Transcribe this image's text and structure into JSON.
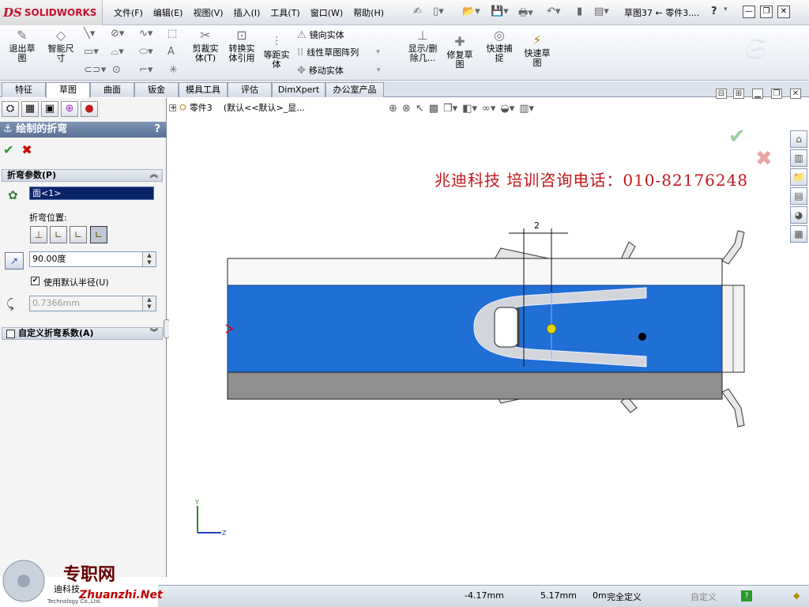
{
  "app": {
    "logo_mark": "DS",
    "logo_text": "SOLIDWORKS",
    "doc_title": "草图37 ← 零件3....",
    "help_glyph": "?",
    "win_min": "—",
    "win_restore": "❐",
    "win_close": "✕"
  },
  "menu": [
    "文件(F)",
    "编辑(E)",
    "视图(V)",
    "插入(I)",
    "工具(T)",
    "窗口(W)",
    "帮助(H)"
  ],
  "ribbon": {
    "exit_sketch": [
      "退出草",
      "图"
    ],
    "smart_dim": [
      "智能尺",
      "寸"
    ],
    "trim": [
      "剪裁实",
      "体(T)"
    ],
    "convert": [
      "转换实",
      "体引用"
    ],
    "offset": [
      "等距实",
      "体"
    ],
    "mirror": "镜向实体",
    "linear_pattern": "线性草图阵列",
    "move": "移动实体",
    "show_delete": [
      "显示/删",
      "除几..."
    ],
    "repair": [
      "修复草",
      "图"
    ],
    "quick_snap": [
      "快速捕",
      "捉"
    ],
    "rapid_sketch": [
      "快速草",
      "图"
    ]
  },
  "tabs": [
    "特征",
    "草图",
    "曲面",
    "钣金",
    "模具工具",
    "评估",
    "DimXpert",
    "办公室产品"
  ],
  "tabs_active": "草图",
  "panel": {
    "title": "绘制的折弯",
    "help": "?",
    "ok": "✔",
    "cancel": "✖",
    "group1_title": "折弯参数(P)",
    "face_value": "面<1>",
    "bend_position_label": "折弯位置:",
    "angle_value": "90.00度",
    "use_default_radius": "使用默认半径(U)",
    "radius_value": "0.7366mm",
    "group2_title": "自定义折弯系数(A)"
  },
  "viewport": {
    "tree_node": "零件3",
    "tree_config": "(默认<<默认>_显...",
    "watermark": "兆迪科技     培训咨询电话：010-82176248",
    "dimension": "2",
    "axis_y": "Y",
    "axis_z": "Z"
  },
  "status": {
    "x": "-4.17mm",
    "y": "5.17mm",
    "z": "0m",
    "state": "完全定义",
    "custom": "自定义"
  },
  "brand": {
    "site_cn": "专职网",
    "site_en": "Zhuanzhi.Net",
    "company": "迪科技",
    "company_en": "Technology Co.,Ltd."
  },
  "colors": {
    "part_blue": "#1f6fd4",
    "dim_text": "#000000",
    "watermark_red": "#c0171d",
    "ok_green": "#2a9a2a"
  }
}
